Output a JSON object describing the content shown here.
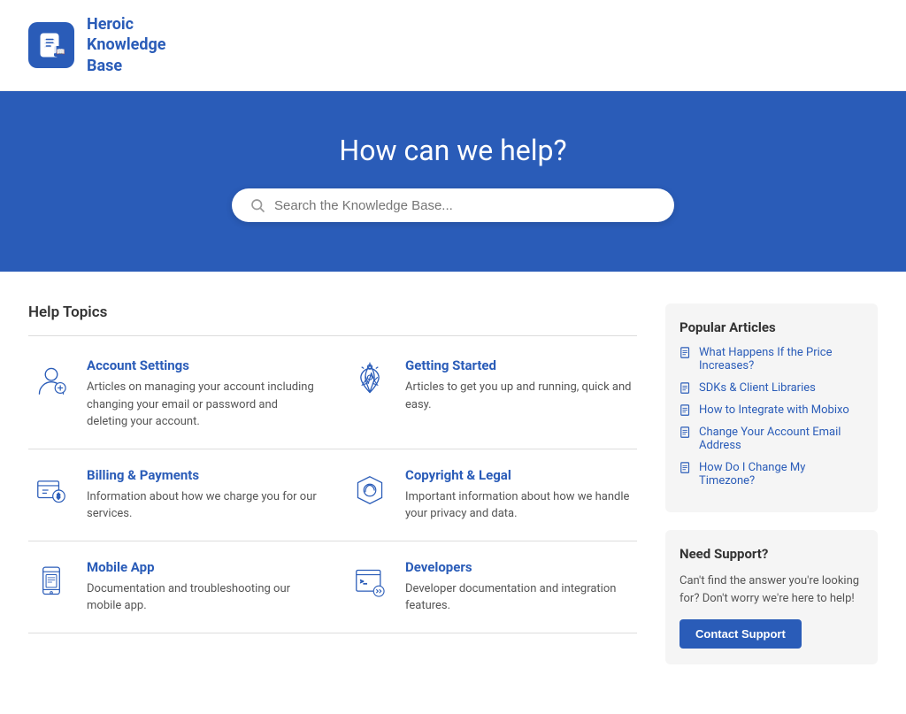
{
  "header": {
    "logo_alt": "Heroic Knowledge Base logo",
    "logo_text": "Heroic\nKnowledge\nBase"
  },
  "hero": {
    "title": "How can we help?",
    "search_placeholder": "Search the Knowledge Base..."
  },
  "topics": {
    "section_title": "Help Topics",
    "rows": [
      [
        {
          "id": "account-settings",
          "title": "Account Settings",
          "desc": "Articles on managing your account including changing your email or password and deleting your account."
        },
        {
          "id": "getting-started",
          "title": "Getting Started",
          "desc": "Articles to get you up and running, quick and easy."
        }
      ],
      [
        {
          "id": "billing-payments",
          "title": "Billing & Payments",
          "desc": "Information about how we charge you for our services."
        },
        {
          "id": "copyright-legal",
          "title": "Copyright & Legal",
          "desc": "Important information about how we handle your privacy and data."
        }
      ],
      [
        {
          "id": "mobile-app",
          "title": "Mobile App",
          "desc": "Documentation and troubleshooting our mobile app."
        },
        {
          "id": "developers",
          "title": "Developers",
          "desc": "Developer documentation and integration features."
        }
      ]
    ]
  },
  "sidebar": {
    "popular_title": "Popular Articles",
    "articles": [
      "What Happens If the Price Increases?",
      "SDKs & Client Libraries",
      "How to Integrate with Mobixo",
      "Change Your Account Email Address",
      "How Do I Change My Timezone?"
    ],
    "support_title": "Need Support?",
    "support_desc": "Can't find the answer you're looking for? Don't worry we're here to help!",
    "contact_label": "Contact Support"
  }
}
